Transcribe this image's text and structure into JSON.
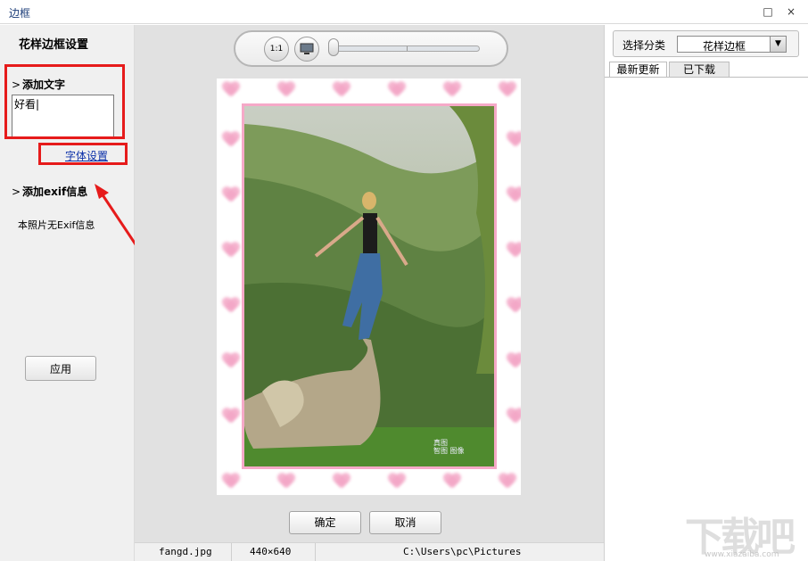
{
  "window": {
    "title": "边框"
  },
  "window_controls": {
    "maximize": "□",
    "close": "×"
  },
  "left": {
    "title": "花样边框设置",
    "add_text_label": "添加文字",
    "text_value": "好看|",
    "font_settings_link": "字体设置",
    "add_exif_label": "添加exif信息",
    "no_exif_text": "本照片无Exif信息",
    "apply_button": "应用",
    "chevron": ">"
  },
  "toolbar": {
    "actual_size_label": "1:1",
    "slider_value": 0
  },
  "photo": {
    "watermark_line1": "真图",
    "watermark_line2": "智图 图像"
  },
  "dialog": {
    "ok": "确定",
    "cancel": "取消"
  },
  "status": {
    "filename": "fangd.jpg",
    "dimensions": "440×640",
    "path": "C:\\Users\\pc\\Pictures"
  },
  "right": {
    "category_label": "选择分类",
    "category_value": "花样边框",
    "dropdown_arrow": "▼",
    "tabs": [
      {
        "label": "最新更新"
      },
      {
        "label": "已下载"
      }
    ]
  },
  "site_watermark": {
    "text": "下载吧",
    "url": "www.xiazaiba.com"
  },
  "colors": {
    "annotation_red": "#e61b1b",
    "border_pink": "#f6a9c8",
    "link_blue": "#0a2fa8"
  }
}
